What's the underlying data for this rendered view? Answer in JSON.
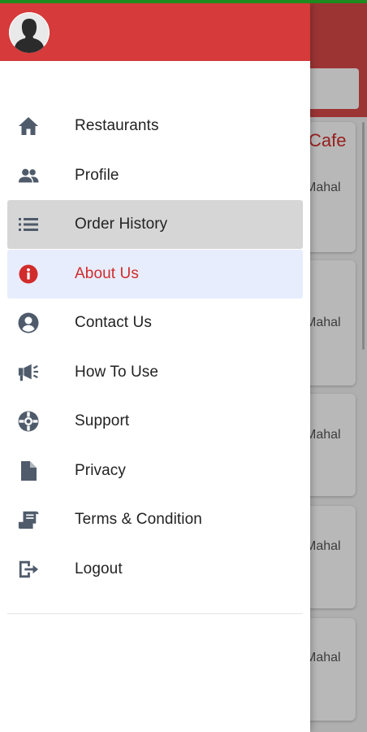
{
  "background_screen": {
    "card_title": "Cafe",
    "card_subtitles": [
      "Mahal",
      "Mahal",
      "Mahal",
      "Mahal",
      "Mahal"
    ]
  },
  "drawer": {
    "menu": [
      {
        "id": "restaurants",
        "label": "Restaurants",
        "icon": "home-icon",
        "state": "normal"
      },
      {
        "id": "profile",
        "label": "Profile",
        "icon": "people-icon",
        "state": "normal"
      },
      {
        "id": "order-history",
        "label": "Order History",
        "icon": "list-icon",
        "state": "pressed"
      },
      {
        "id": "about-us",
        "label": "About Us",
        "icon": "info-icon",
        "state": "active"
      },
      {
        "id": "contact-us",
        "label": "Contact Us",
        "icon": "account-circle-icon",
        "state": "normal"
      },
      {
        "id": "how-to-use",
        "label": "How To Use",
        "icon": "megaphone-icon",
        "state": "normal"
      },
      {
        "id": "support",
        "label": "Support",
        "icon": "lifebuoy-icon",
        "state": "normal"
      },
      {
        "id": "privacy",
        "label": "Privacy",
        "icon": "file-icon",
        "state": "normal"
      },
      {
        "id": "terms",
        "label": "Terms & Condition",
        "icon": "receipt-icon",
        "state": "normal"
      },
      {
        "id": "logout",
        "label": "Logout",
        "icon": "logout-icon",
        "state": "normal"
      }
    ]
  },
  "colors": {
    "header_red": "#d63a3a",
    "accent_red": "#d12b2b",
    "active_bg": "#e7edfc",
    "pressed_bg": "#d6d6d6",
    "icon_slate": "#4f5b6b",
    "status_green": "#1e8b1e"
  }
}
